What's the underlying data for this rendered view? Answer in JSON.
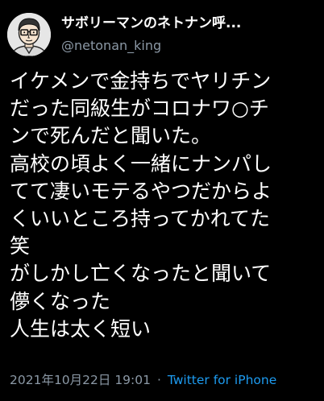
{
  "tweet": {
    "display_name": "サボリーマンのネトナン呼...",
    "handle": "@netonan_king",
    "body_lines": [
      "イケメンで金持ちでヤリチン",
      "だった同級生がコロナワ○チ",
      "ンで死んだと聞いた。",
      "高校の頃よく一緒にナンパし",
      "てて凄いモテるやつだからよ",
      "くいいところ持ってかれてた",
      "笑",
      "がしかし亡くなったと聞いて",
      "儚くなった",
      "人生は太く短い"
    ],
    "timestamp": "2021年10月22日 19:01",
    "separator": "·",
    "client": "Twitter for iPhone"
  },
  "colors": {
    "background": "#000000",
    "text": "#ffffff",
    "secondary": "#8b98a5",
    "link": "#1d9bf0"
  },
  "icons": {
    "avatar": "cartoon-man-with-glasses-icon"
  }
}
